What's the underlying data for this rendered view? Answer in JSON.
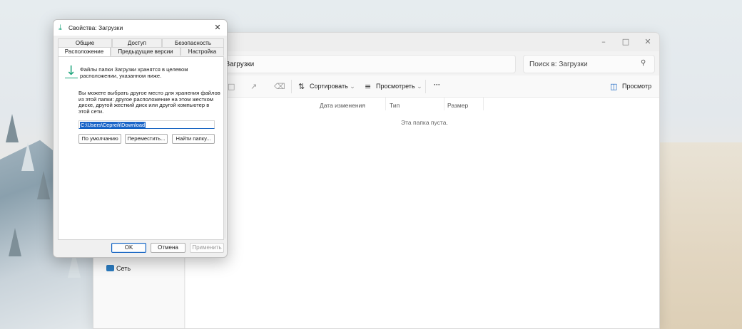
{
  "explorer": {
    "address_text": "Загрузки",
    "search_placeholder": "Поиск в: Загрузки",
    "toolbar": {
      "sort_label": "Сортировать",
      "view_label": "Просмотреть",
      "more_label": "···",
      "preview_label": "Просмотр"
    },
    "columns": [
      "Дата изменения",
      "Тип",
      "Размер"
    ],
    "empty_message": "Эта папка пуста.",
    "nav": {
      "network_label": "Сеть"
    }
  },
  "dialog": {
    "title": "Свойства: Загрузки",
    "tabs_row1": [
      "Общие",
      "Доступ",
      "Безопасность"
    ],
    "tabs_row2": [
      "Расположение",
      "Предыдущие версии",
      "Настройка"
    ],
    "active_tab": "Расположение",
    "info_text": "Файлы папки Загрузки хранятся в целевом расположении, указанном ниже.",
    "description": "Вы можете выбрать другое место для хранения файлов из этой папки: другое расположение на этом жестком диске, другой жесткий диск или другой компьютер в этой сети.",
    "path_value": "C:\\Users\\Сергей\\Download",
    "buttons": {
      "default": "По умолчанию",
      "move": "Переместить...",
      "find": "Найти папку..."
    },
    "footer": {
      "ok": "OK",
      "cancel": "Отмена",
      "apply": "Применить"
    }
  },
  "colors": {
    "accent": "#1060c0",
    "download_green": "#1aa37a"
  }
}
